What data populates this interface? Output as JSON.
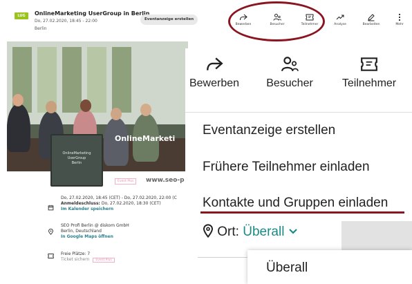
{
  "header": {
    "logo_text": "LUG",
    "event_title": "OnlineMarketing UserGroup in Berlin",
    "event_date": "Do, 27.02.2020, 18:45 - 22:00",
    "event_city": "Berlin",
    "create_button": "Eventanzeige erstellen",
    "tools": [
      {
        "label": "Bewerben",
        "icon": "share-arrow-icon"
      },
      {
        "label": "Besucher",
        "icon": "people-icon"
      },
      {
        "label": "Teilnehmer",
        "icon": "ticket-icon"
      },
      {
        "label": "Analyse",
        "icon": "trend-chart-icon"
      },
      {
        "label": "Bearbeiten",
        "icon": "pencil-icon"
      },
      {
        "label": "Mehr",
        "icon": "more-dots-icon"
      }
    ],
    "highlight_color": "#8a1420"
  },
  "event_page": {
    "photo_overlay_text": "OnlineMarketi",
    "board_lines": [
      "OnlineMarketing",
      "UserGroup",
      "Berlin"
    ],
    "event_plus_tag": "Event Plus",
    "seo_text": "www.seo-p",
    "date_line": "Do, 27.02.2020, 18:45 (CET) - Do, 27.02.2020, 22:00 (C",
    "deadline_label": "Anmeldeschluss:",
    "deadline_value": "Do, 27.02.2020, 18:30 (CET)",
    "calendar_link": "Im Kalender speichern",
    "venue_name": "SEO Profi Berlin @ diskom GmbH",
    "venue_city": "Berlin, Deutschland",
    "maps_link": "In Google Maps öffnen",
    "seats": "Freie Plätze: 7",
    "ticket_text": "Ticket sichern",
    "ticket_tag": "Event Plus"
  },
  "overlay": {
    "tools": [
      {
        "label": "Bewerben",
        "icon": "share-arrow-icon"
      },
      {
        "label": "Besucher",
        "icon": "people-icon"
      },
      {
        "label": "Teilnehmer",
        "icon": "ticket-icon"
      }
    ],
    "menu": [
      "Eventanzeige erstellen",
      "Frühere Teilnehmer einladen",
      "Kontakte und Gruppen einladen"
    ],
    "location_label": "Ort:",
    "location_value": "Überall",
    "dropdown_option": "Überall",
    "accent_color": "#1a8a86",
    "underline_color": "#8a1420"
  }
}
